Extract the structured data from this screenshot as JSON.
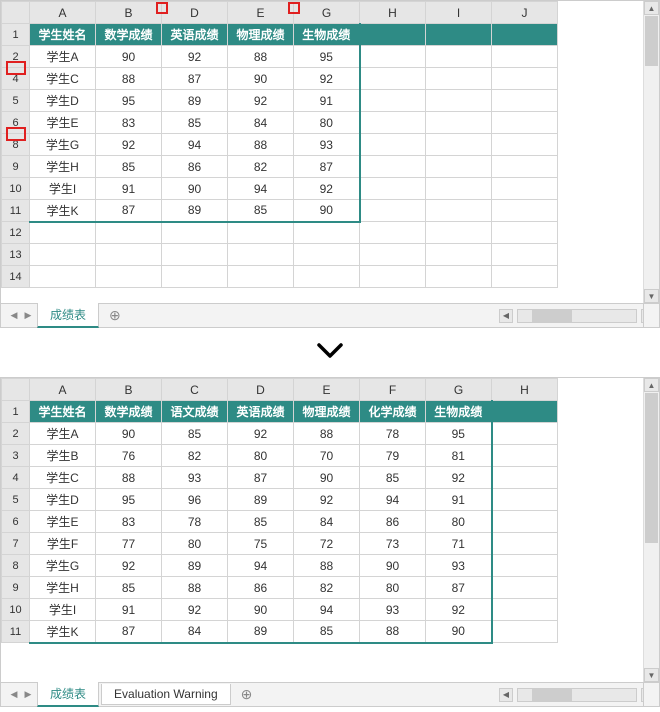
{
  "top": {
    "col_headers": [
      "A",
      "B",
      "D",
      "E",
      "G",
      "H",
      "I",
      "J"
    ],
    "row_headers": [
      "1",
      "2",
      "4",
      "5",
      "6",
      "8",
      "9",
      "10",
      "11",
      "12",
      "13",
      "14"
    ],
    "hidden_col_markers": [
      {
        "after_index": 1
      },
      {
        "after_index": 3
      }
    ],
    "hidden_row_markers": [
      {
        "after_row": "2"
      },
      {
        "after_row": "6"
      }
    ],
    "header_row": [
      "学生姓名",
      "数学成绩",
      "英语成绩",
      "物理成绩",
      "生物成绩",
      "",
      "",
      ""
    ],
    "data_rows": [
      [
        "学生A",
        "90",
        "92",
        "88",
        "95",
        "",
        "",
        ""
      ],
      [
        "学生C",
        "88",
        "87",
        "90",
        "92",
        "",
        "",
        ""
      ],
      [
        "学生D",
        "95",
        "89",
        "92",
        "91",
        "",
        "",
        ""
      ],
      [
        "学生E",
        "83",
        "85",
        "84",
        "80",
        "",
        "",
        ""
      ],
      [
        "学生G",
        "92",
        "94",
        "88",
        "93",
        "",
        "",
        ""
      ],
      [
        "学生H",
        "85",
        "86",
        "82",
        "87",
        "",
        "",
        ""
      ],
      [
        "学生I",
        "91",
        "90",
        "94",
        "92",
        "",
        "",
        ""
      ],
      [
        "学生K",
        "87",
        "89",
        "85",
        "90",
        "",
        "",
        ""
      ]
    ],
    "tabs": {
      "active": "成绩表",
      "add": "⊕"
    }
  },
  "bottom": {
    "col_headers": [
      "A",
      "B",
      "C",
      "D",
      "E",
      "F",
      "G",
      "H"
    ],
    "row_headers": [
      "1",
      "2",
      "3",
      "4",
      "5",
      "6",
      "7",
      "8",
      "9",
      "10",
      "11"
    ],
    "header_row": [
      "学生姓名",
      "数学成绩",
      "语文成绩",
      "英语成绩",
      "物理成绩",
      "化学成绩",
      "生物成绩",
      ""
    ],
    "data_rows": [
      [
        "学生A",
        "90",
        "85",
        "92",
        "88",
        "78",
        "95",
        ""
      ],
      [
        "学生B",
        "76",
        "82",
        "80",
        "70",
        "79",
        "81",
        ""
      ],
      [
        "学生C",
        "88",
        "93",
        "87",
        "90",
        "85",
        "92",
        ""
      ],
      [
        "学生D",
        "95",
        "96",
        "89",
        "92",
        "94",
        "91",
        ""
      ],
      [
        "学生E",
        "83",
        "78",
        "85",
        "84",
        "86",
        "80",
        ""
      ],
      [
        "学生F",
        "77",
        "80",
        "75",
        "72",
        "73",
        "71",
        ""
      ],
      [
        "学生G",
        "92",
        "89",
        "94",
        "88",
        "90",
        "93",
        ""
      ],
      [
        "学生H",
        "85",
        "88",
        "86",
        "82",
        "80",
        "87",
        ""
      ],
      [
        "学生I",
        "91",
        "92",
        "90",
        "94",
        "93",
        "92",
        ""
      ],
      [
        "学生K",
        "87",
        "84",
        "89",
        "85",
        "88",
        "90",
        ""
      ]
    ],
    "tabs": {
      "active": "成绩表",
      "other": "Evaluation Warning",
      "add": "⊕"
    }
  },
  "chart_data": {
    "type": "table",
    "title_top": "filtered (hidden cols C,F and hidden rows 3,7)",
    "title_bottom": "full",
    "columns": [
      "学生姓名",
      "数学成绩",
      "语文成绩",
      "英语成绩",
      "物理成绩",
      "化学成绩",
      "生物成绩"
    ],
    "rows": [
      {
        "name": "学生A",
        "math": 90,
        "chinese": 85,
        "english": 92,
        "physics": 88,
        "chemistry": 78,
        "biology": 95
      },
      {
        "name": "学生B",
        "math": 76,
        "chinese": 82,
        "english": 80,
        "physics": 70,
        "chemistry": 79,
        "biology": 81
      },
      {
        "name": "学生C",
        "math": 88,
        "chinese": 93,
        "english": 87,
        "physics": 90,
        "chemistry": 85,
        "biology": 92
      },
      {
        "name": "学生D",
        "math": 95,
        "chinese": 96,
        "english": 89,
        "physics": 92,
        "chemistry": 94,
        "biology": 91
      },
      {
        "name": "学生E",
        "math": 83,
        "chinese": 78,
        "english": 85,
        "physics": 84,
        "chemistry": 86,
        "biology": 80
      },
      {
        "name": "学生F",
        "math": 77,
        "chinese": 80,
        "english": 75,
        "physics": 72,
        "chemistry": 73,
        "biology": 71
      },
      {
        "name": "学生G",
        "math": 92,
        "chinese": 89,
        "english": 94,
        "physics": 88,
        "chemistry": 90,
        "biology": 93
      },
      {
        "name": "学生H",
        "math": 85,
        "chinese": 88,
        "english": 86,
        "physics": 82,
        "chemistry": 80,
        "biology": 87
      },
      {
        "name": "学生I",
        "math": 91,
        "chinese": 92,
        "english": 90,
        "physics": 94,
        "chemistry": 93,
        "biology": 92
      },
      {
        "name": "学生K",
        "math": 87,
        "chinese": 84,
        "english": 89,
        "physics": 85,
        "chemistry": 88,
        "biology": 90
      }
    ]
  }
}
